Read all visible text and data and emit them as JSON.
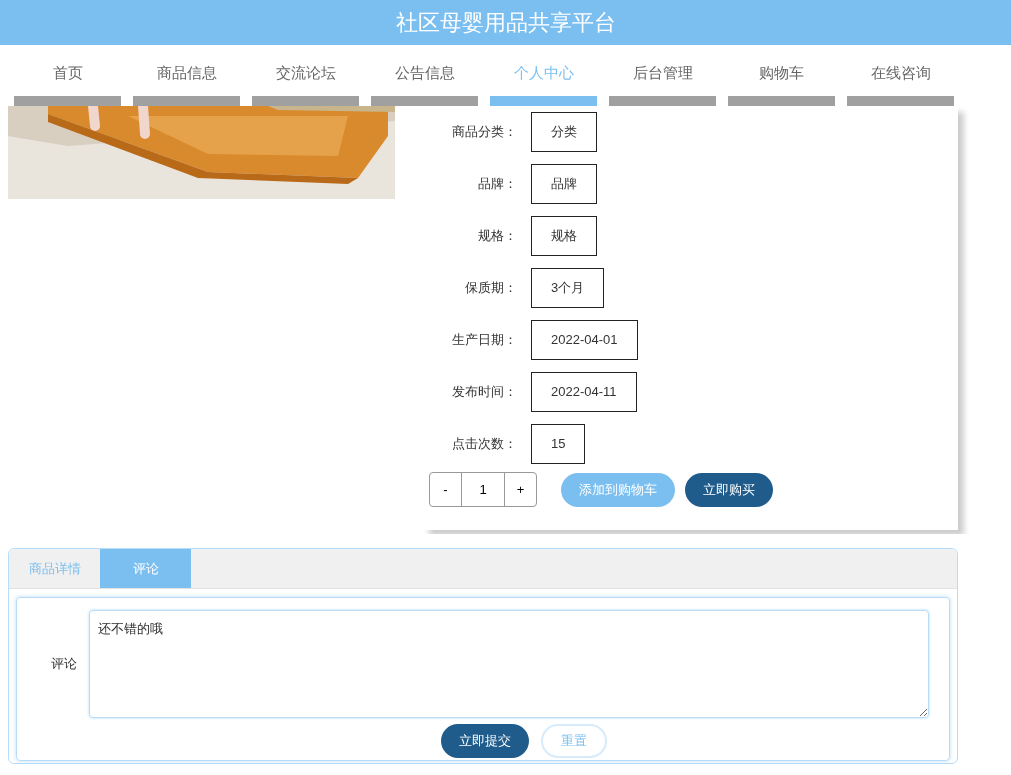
{
  "header": {
    "title": "社区母婴用品共享平台"
  },
  "nav": [
    {
      "label": "首页",
      "selected": false
    },
    {
      "label": "商品信息",
      "selected": false
    },
    {
      "label": "交流论坛",
      "selected": false
    },
    {
      "label": "公告信息",
      "selected": false
    },
    {
      "label": "个人中心",
      "selected": true
    },
    {
      "label": "后台管理",
      "selected": false
    },
    {
      "label": "购物车",
      "selected": false
    },
    {
      "label": "在线咨询",
      "selected": false
    }
  ],
  "product": {
    "fields": [
      {
        "label": "商品分类：",
        "value": "分类"
      },
      {
        "label": "品牌：",
        "value": "品牌"
      },
      {
        "label": "规格：",
        "value": "规格"
      },
      {
        "label": "保质期：",
        "value": "3个月"
      },
      {
        "label": "生产日期：",
        "value": "2022-04-01"
      },
      {
        "label": "发布时间：",
        "value": "2022-04-11"
      },
      {
        "label": "点击次数：",
        "value": "15"
      }
    ],
    "quantity": {
      "minus": "-",
      "value": "1",
      "plus": "+"
    },
    "buttons": [
      {
        "label": "添加到购物车",
        "kind": "secondary"
      },
      {
        "label": "立即购买",
        "kind": "primary"
      }
    ]
  },
  "tabs": [
    {
      "label": "商品详情",
      "selected": false
    },
    {
      "label": "评论",
      "selected": true
    }
  ],
  "comment_form": {
    "label": "评论",
    "value": "还不错的哦",
    "buttons": [
      {
        "label": "立即提交",
        "kind": "primary"
      },
      {
        "label": "重置",
        "kind": "outline"
      }
    ]
  }
}
